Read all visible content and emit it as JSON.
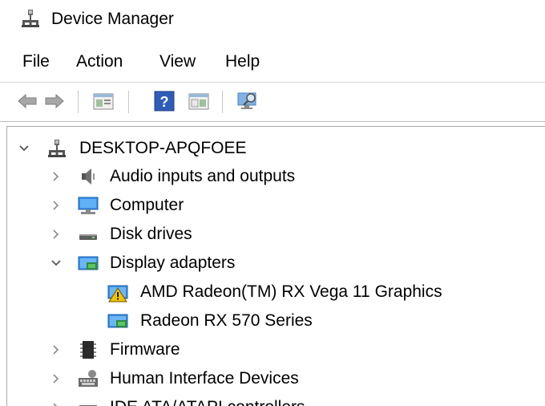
{
  "window": {
    "title": "Device Manager",
    "icon": "device-manager-icon"
  },
  "menu": [
    {
      "label": "File"
    },
    {
      "label": "Action"
    },
    {
      "label": "View"
    },
    {
      "label": "Help"
    }
  ],
  "toolbar": {
    "buttons": [
      "back-arrow-icon",
      "forward-arrow-icon",
      "properties-icon",
      "help-icon",
      "update-driver-icon",
      "scan-hardware-icon"
    ]
  },
  "tree": {
    "root": {
      "label": "DESKTOP-APQFOEE",
      "expanded": true,
      "icon": "computer-network-icon"
    },
    "categories": [
      {
        "label": "Audio inputs and outputs",
        "expanded": false,
        "icon": "speaker-icon"
      },
      {
        "label": "Computer",
        "expanded": false,
        "icon": "monitor-icon"
      },
      {
        "label": "Disk drives",
        "expanded": false,
        "icon": "disk-drive-icon"
      },
      {
        "label": "Display adapters",
        "expanded": true,
        "icon": "display-adapter-icon",
        "children": [
          {
            "label": "AMD Radeon(TM) RX Vega 11 Graphics",
            "icon": "display-adapter-warning-icon",
            "warning": true
          },
          {
            "label": "Radeon RX 570 Series",
            "icon": "display-adapter-icon",
            "warning": false
          }
        ]
      },
      {
        "label": "Firmware",
        "expanded": false,
        "icon": "firmware-chip-icon"
      },
      {
        "label": "Human Interface Devices",
        "expanded": false,
        "icon": "hid-icon"
      },
      {
        "label": "IDE ATA/ATAPI controllers",
        "expanded": false,
        "icon": "ide-controller-icon"
      }
    ]
  },
  "colors": {
    "chevron": "#555555",
    "separator": "#c8c8c8",
    "warning": "#f2c200",
    "accent": "#2a7fd4"
  }
}
